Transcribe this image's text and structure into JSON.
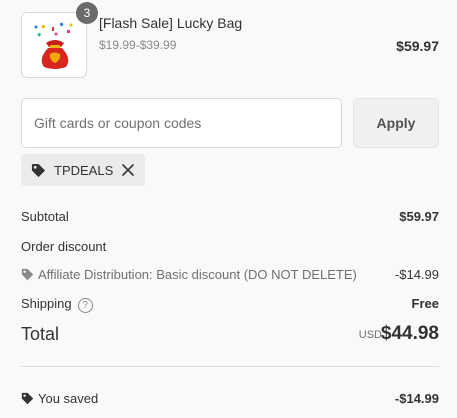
{
  "product": {
    "title": "[Flash Sale] Lucky Bag",
    "variant": "$19.99-$39.99",
    "price": "$59.97",
    "quantity": "3"
  },
  "coupon": {
    "placeholder": "Gift cards or coupon codes",
    "apply_label": "Apply",
    "applied_code": "TPDEALS"
  },
  "summary": {
    "subtotal_label": "Subtotal",
    "subtotal_value": "$59.97",
    "order_discount_label": "Order discount",
    "discount_name": "Affiliate Distribution: Basic discount (DO NOT DELETE)",
    "discount_value": "-$14.99",
    "shipping_label": "Shipping",
    "shipping_help": "?",
    "shipping_value": "Free",
    "total_label": "Total",
    "total_currency": "USD",
    "total_value": "$44.98",
    "saved_label": "You saved",
    "saved_value": "-$14.99"
  },
  "colors": {
    "background": "#f9f9f9",
    "bag_red": "#d7261e",
    "tag_gray": "#ebebeb"
  }
}
